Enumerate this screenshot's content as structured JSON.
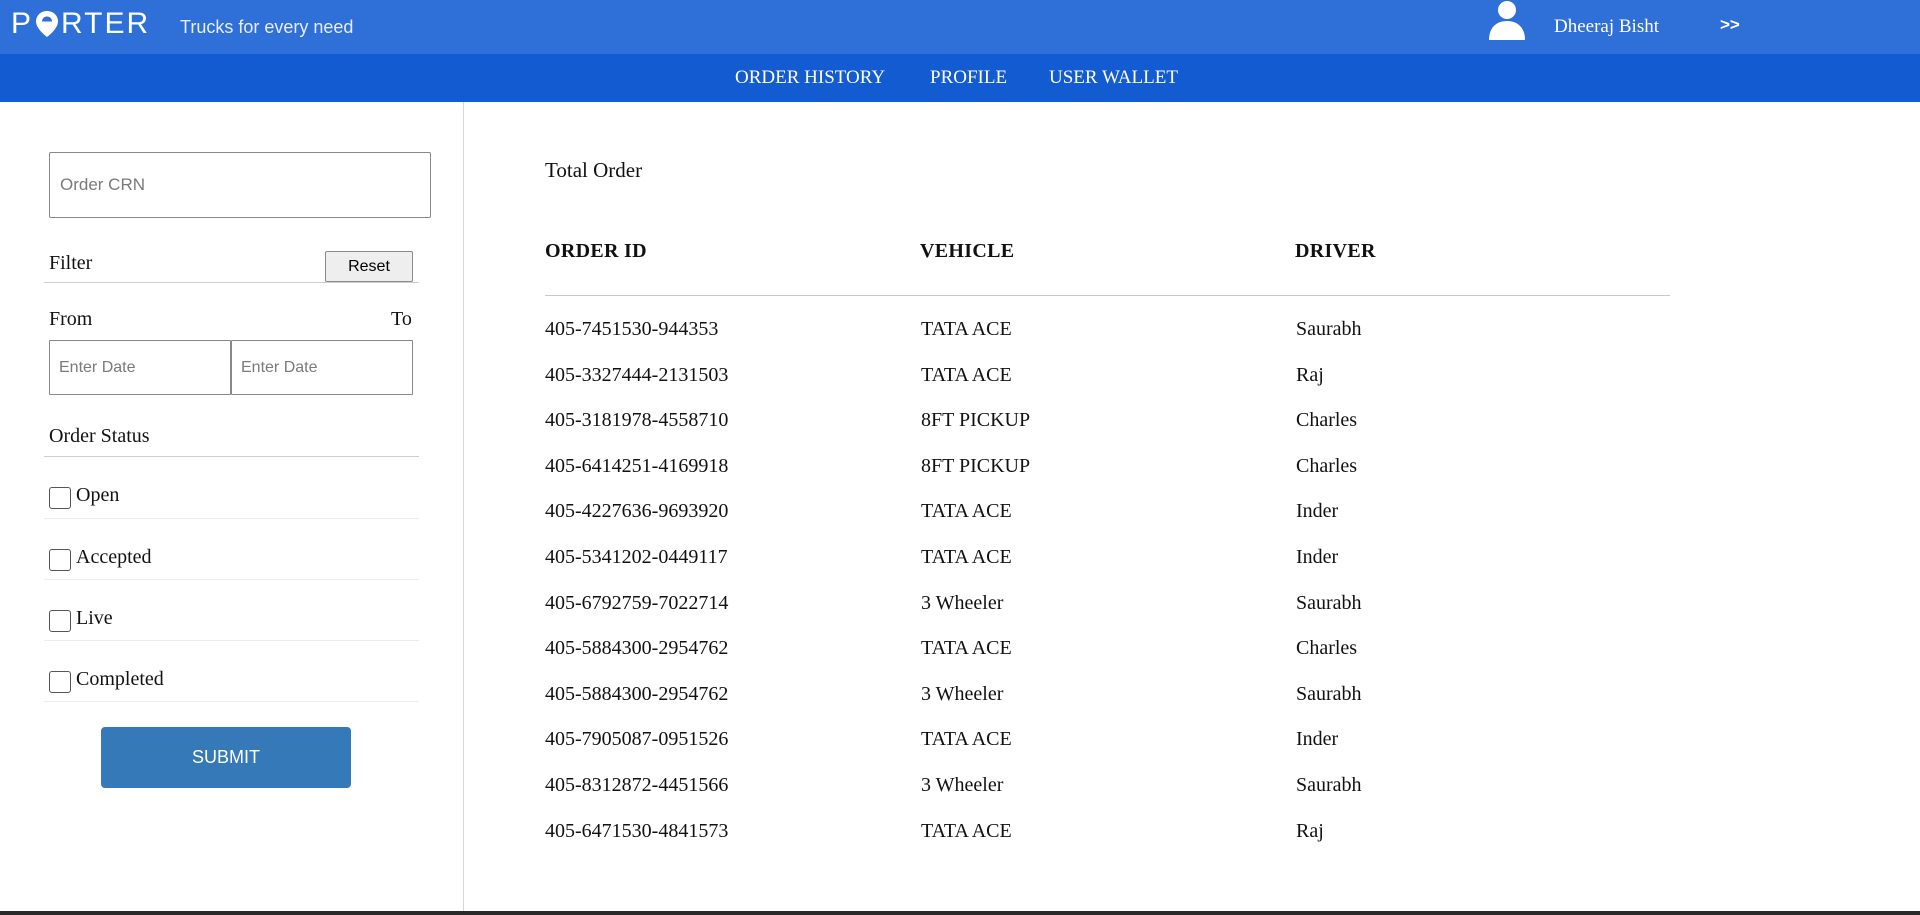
{
  "header": {
    "logo_text": "PORTER",
    "tagline": "Trucks for every need",
    "user_name": "Dheeraj Bisht",
    "expand_label": ">>",
    "bg_color": "#2f6fd8"
  },
  "nav": {
    "bg_color": "#135bd1",
    "items": [
      {
        "label": "ORDER HISTORY"
      },
      {
        "label": "PROFILE"
      },
      {
        "label": "USER WALLET"
      }
    ]
  },
  "sidebar": {
    "crn_placeholder": "Order CRN",
    "filter_label": "Filter",
    "reset_label": "Reset",
    "from_label": "From",
    "to_label": "To",
    "from_placeholder": "Enter Date",
    "to_placeholder": "Enter Date",
    "status_label": "Order Status",
    "statuses": [
      {
        "label": "Open",
        "checked": false
      },
      {
        "label": "Accepted",
        "checked": false
      },
      {
        "label": "Live",
        "checked": false
      },
      {
        "label": "Completed",
        "checked": false
      }
    ],
    "submit_label": "SUBMIT",
    "submit_color": "#3579b8"
  },
  "main": {
    "total_label": "Total Order",
    "columns": [
      "ORDER ID",
      "VEHICLE",
      "DRIVER"
    ],
    "rows": [
      {
        "order_id": "405-7451530-944353",
        "vehicle": "TATA ACE",
        "driver": "Saurabh"
      },
      {
        "order_id": "405-3327444-2131503",
        "vehicle": "TATA ACE",
        "driver": "Raj"
      },
      {
        "order_id": "405-3181978-4558710",
        "vehicle": "8FT PICKUP",
        "driver": "Charles"
      },
      {
        "order_id": "405-6414251-4169918",
        "vehicle": "8FT PICKUP",
        "driver": "Charles"
      },
      {
        "order_id": "405-4227636-9693920",
        "vehicle": "TATA ACE",
        "driver": "Inder"
      },
      {
        "order_id": "405-5341202-0449117",
        "vehicle": "TATA ACE",
        "driver": "Inder"
      },
      {
        "order_id": "405-6792759-7022714",
        "vehicle": "3 Wheeler",
        "driver": "Saurabh"
      },
      {
        "order_id": "405-5884300-2954762",
        "vehicle": "TATA ACE",
        "driver": "Charles"
      },
      {
        "order_id": "405-5884300-2954762",
        "vehicle": "3 Wheeler",
        "driver": "Saurabh"
      },
      {
        "order_id": "405-7905087-0951526",
        "vehicle": "TATA ACE",
        "driver": "Inder"
      },
      {
        "order_id": "405-8312872-4451566",
        "vehicle": "3 Wheeler",
        "driver": "Saurabh"
      },
      {
        "order_id": "405-6471530-4841573",
        "vehicle": "TATA ACE",
        "driver": "Raj"
      }
    ]
  }
}
